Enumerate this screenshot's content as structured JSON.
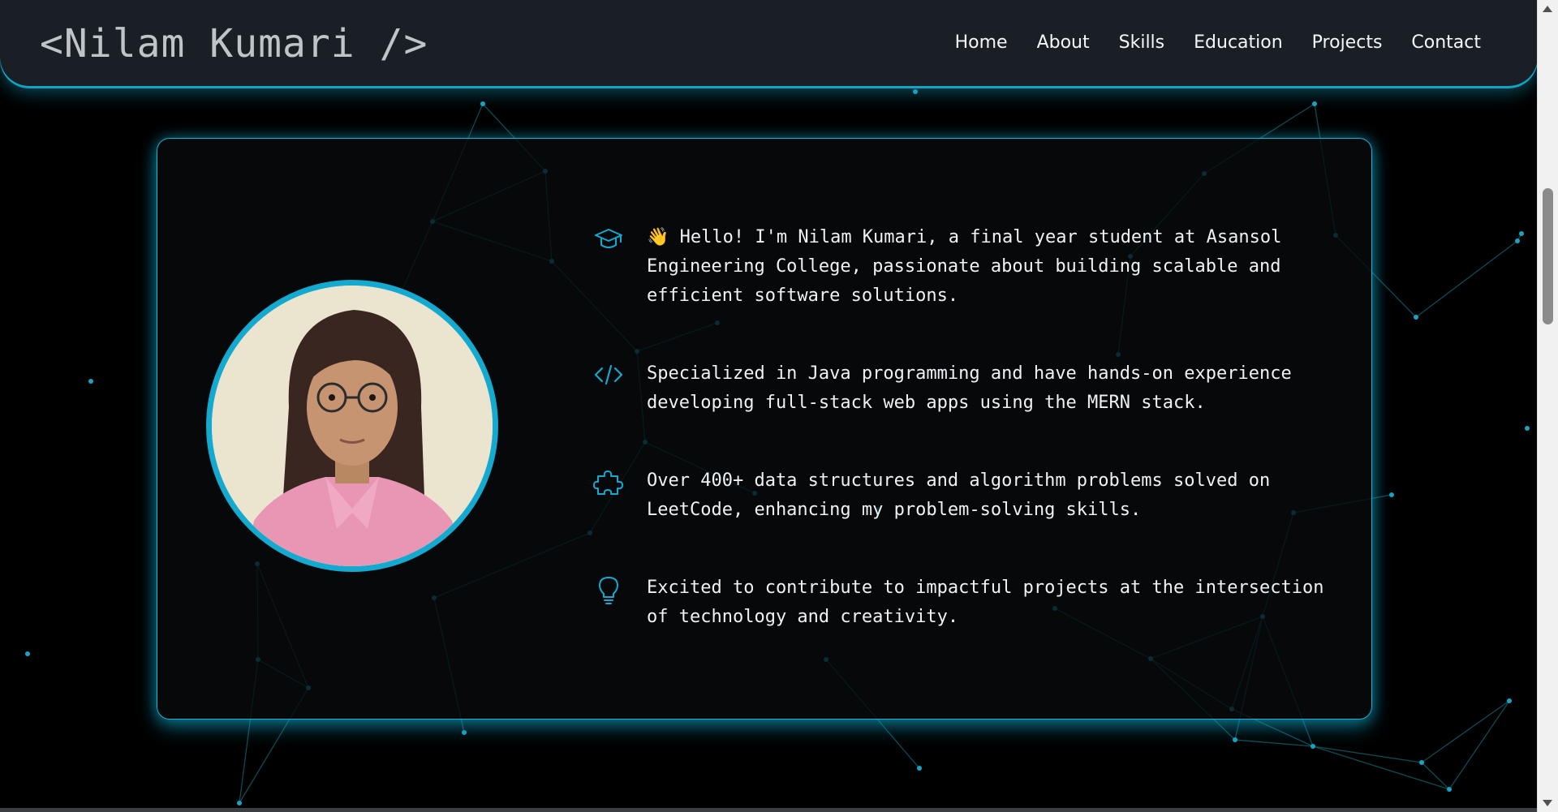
{
  "brand": "<Nilam Kumari />",
  "nav": [
    "Home",
    "About",
    "Skills",
    "Education",
    "Projects",
    "Contact"
  ],
  "about": {
    "photo_alt": "Nilam Kumari portrait",
    "facts": [
      {
        "icon": "graduation-cap-icon",
        "text": "👋 Hello! I'm Nilam Kumari, a final year student at Asansol Engineering College, passionate about building scalable and efficient software solutions."
      },
      {
        "icon": "code-icon",
        "text": "Specialized in Java programming and have hands-on experience developing full-stack web apps using the MERN stack."
      },
      {
        "icon": "puzzle-icon",
        "text": "Over 400+ data structures and algorithm problems solved on LeetCode, enhancing my problem-solving skills."
      },
      {
        "icon": "lightbulb-icon",
        "text": "Excited to contribute to impactful projects at the intersection of technology and creativity."
      }
    ]
  },
  "colors": {
    "accent": "#14a9cf",
    "navbar_bg": "#1a1f26",
    "page_bg": "#000000"
  }
}
